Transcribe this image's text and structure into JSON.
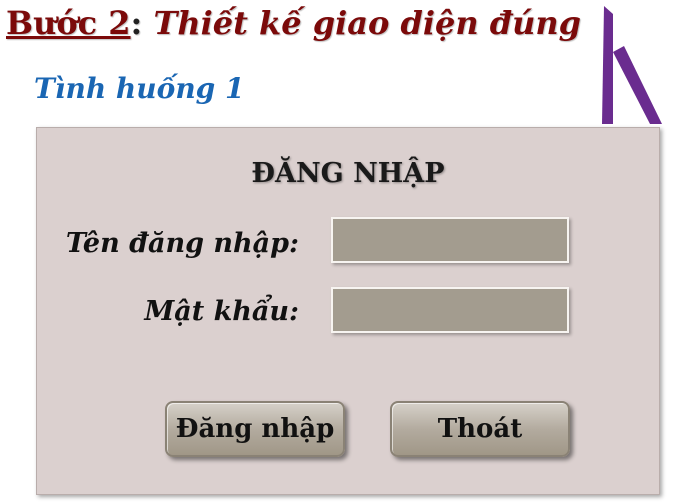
{
  "heading": {
    "step": "Bước 2",
    "separator": ":",
    "topic": "Thiết kế giao diện đúng"
  },
  "subheading": "Tình huống 1",
  "login_form": {
    "title": "ĐĂNG NHẬP",
    "username_label": "Tên đăng nhập:",
    "username_value": "",
    "password_label": "Mật khẩu:",
    "password_value": "",
    "login_button": "Đăng nhập",
    "exit_button": "Thoát"
  },
  "colors": {
    "heading": "#7b0a0a",
    "subheading": "#1a66b3",
    "panel_background": "#dbd0cf",
    "field_background": "#a39c8f",
    "logo": "#6a2c8f"
  },
  "icons": {
    "logo": "h-letter-logo-icon"
  }
}
